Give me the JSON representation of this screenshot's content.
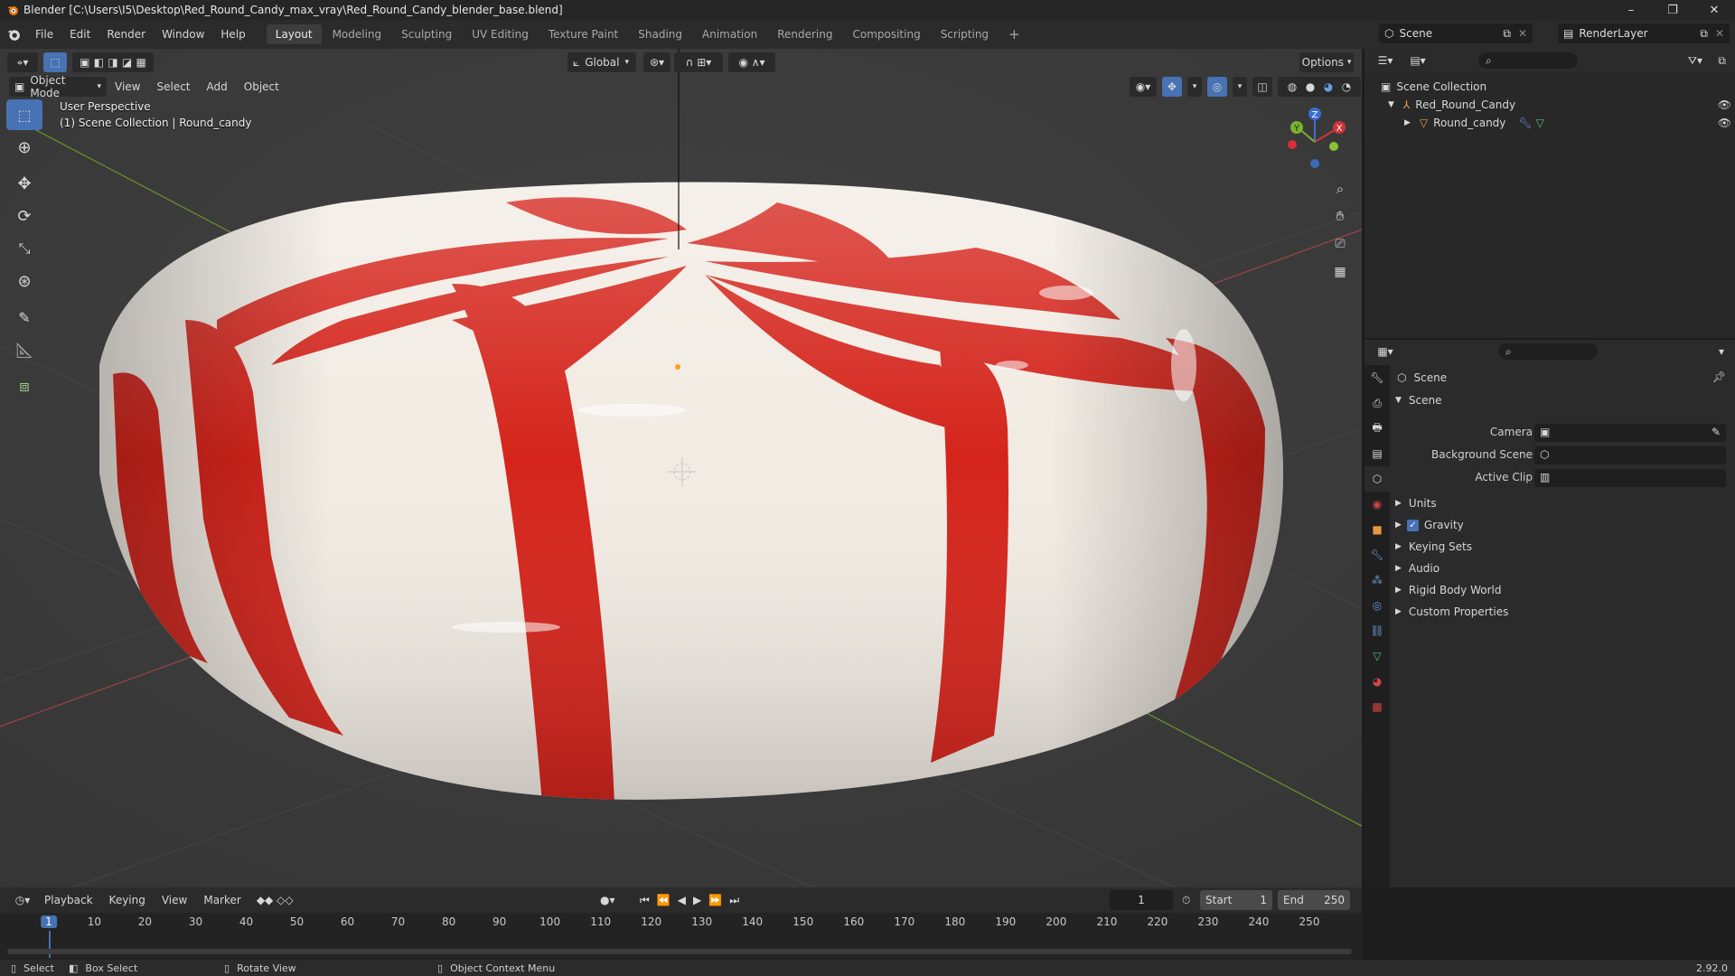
{
  "window": {
    "title": "Blender [C:\\Users\\I5\\Desktop\\Red_Round_Candy_max_vray\\Red_Round_Candy_blender_base.blend]",
    "controls": [
      "–",
      "❐",
      "✕"
    ]
  },
  "menu": {
    "items": [
      "File",
      "Edit",
      "Render",
      "Window",
      "Help"
    ],
    "workspaces": [
      "Layout",
      "Modeling",
      "Sculpting",
      "UV Editing",
      "Texture Paint",
      "Shading",
      "Animation",
      "Rendering",
      "Compositing",
      "Scripting"
    ],
    "active_workspace": "Layout",
    "add_tab": "+",
    "scene": "Scene",
    "render_layer": "RenderLayer"
  },
  "viewport": {
    "transform_orientation": "Global",
    "options_label": "Options",
    "mode": "Object Mode",
    "header_menus": [
      "View",
      "Select",
      "Add",
      "Object"
    ],
    "perspective_label": "User Perspective",
    "collection_label": "(1) Scene Collection | Round_candy",
    "gizmo_axes": [
      "X",
      "Y",
      "Z"
    ],
    "colors": {
      "background": "#3a3a3a",
      "candy_red": "#d8261c",
      "candy_white": "#f2ece4",
      "x_axis": "#c0392b",
      "y_axis": "#7fb02f"
    }
  },
  "outliner": {
    "root": "Scene Collection",
    "items": [
      {
        "name": "Red_Round_Candy",
        "icon": "empty-icon"
      },
      {
        "name": "Round_candy",
        "icon": "mesh-icon"
      }
    ]
  },
  "properties": {
    "context": "Scene",
    "panel_title": "Scene",
    "fields": [
      {
        "label": "Camera"
      },
      {
        "label": "Background Scene"
      },
      {
        "label": "Active Clip"
      }
    ],
    "subpanels": [
      {
        "label": "Units",
        "checkbox": false
      },
      {
        "label": "Gravity",
        "checkbox": true
      },
      {
        "label": "Keying Sets",
        "checkbox": false
      },
      {
        "label": "Audio",
        "checkbox": false
      },
      {
        "label": "Rigid Body World",
        "checkbox": false
      },
      {
        "label": "Custom Properties",
        "checkbox": false
      }
    ]
  },
  "timeline": {
    "menus": [
      "Playback",
      "Keying",
      "View",
      "Marker"
    ],
    "current_frame": "1",
    "start_label": "Start",
    "start_value": "1",
    "end_label": "End",
    "end_value": "250",
    "ticks": [
      "1",
      "10",
      "20",
      "30",
      "40",
      "50",
      "60",
      "70",
      "80",
      "90",
      "100",
      "110",
      "120",
      "130",
      "140",
      "150",
      "160",
      "170",
      "180",
      "190",
      "200",
      "210",
      "220",
      "230",
      "240",
      "250"
    ]
  },
  "statusbar": {
    "select": "Select",
    "box_select": "Box Select",
    "rotate_view": "Rotate View",
    "context_menu": "Object Context Menu",
    "version": "2.92.0"
  }
}
